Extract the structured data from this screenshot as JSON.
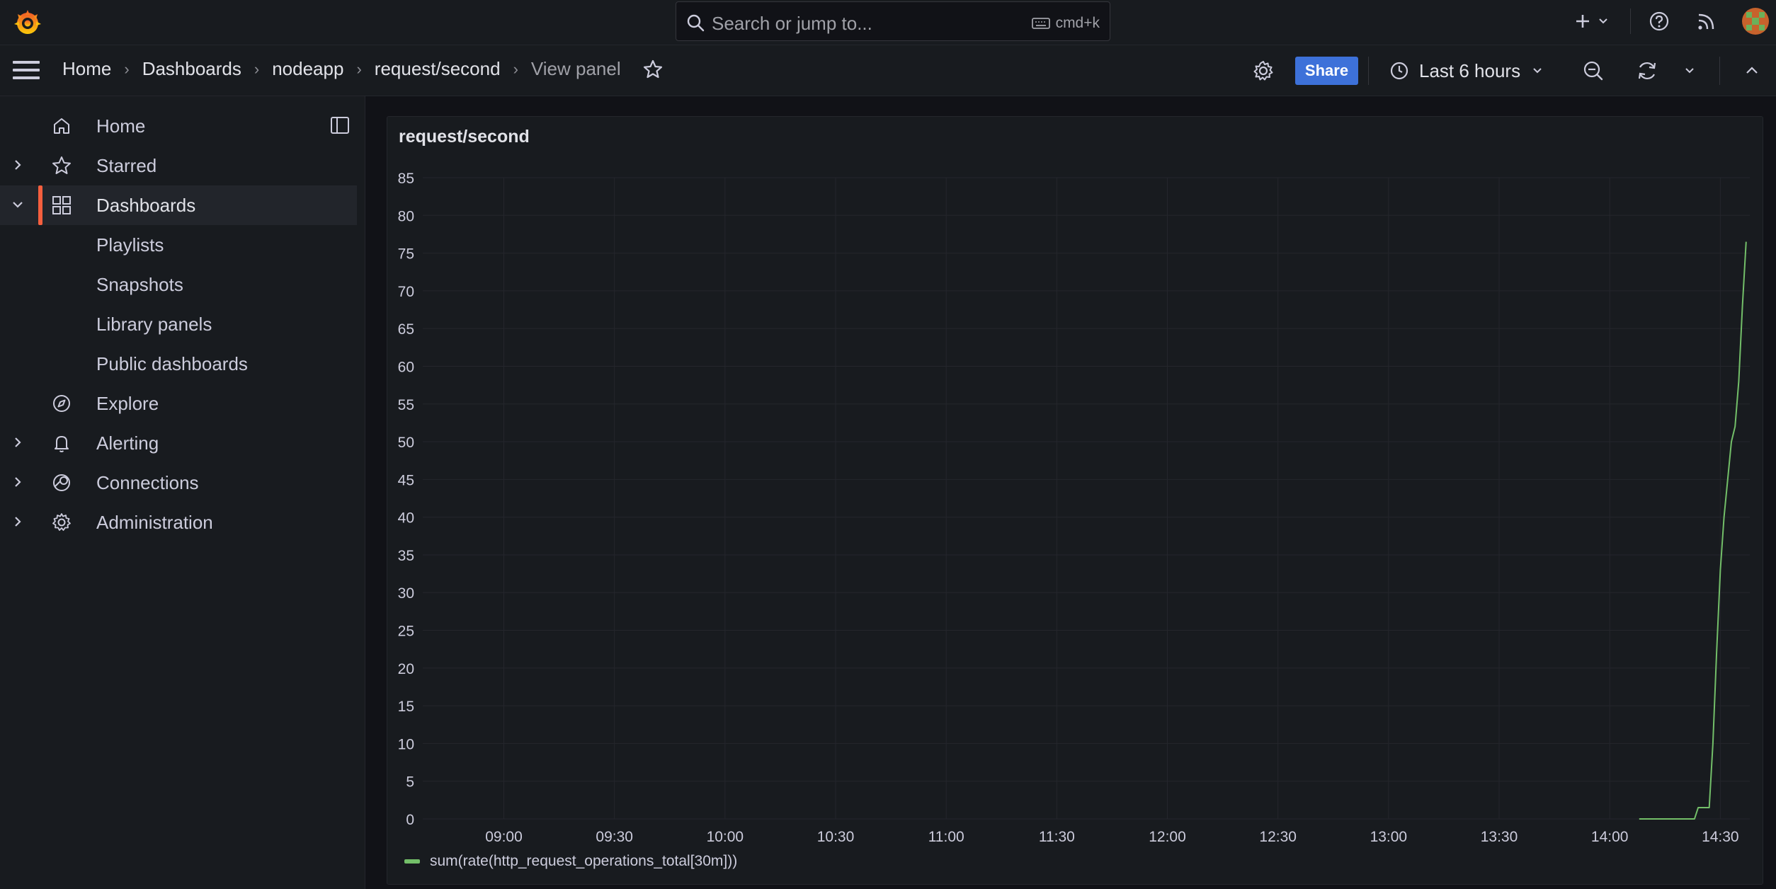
{
  "search": {
    "placeholder": "Search or jump to...",
    "shortcut": "cmd+k"
  },
  "breadcrumb": {
    "items": [
      "Home",
      "Dashboards",
      "nodeapp",
      "request/second",
      "View panel"
    ]
  },
  "toolbar": {
    "share_label": "Share",
    "time_range": "Last 6 hours"
  },
  "sidebar": {
    "items": [
      {
        "label": "Home",
        "icon": "home-icon",
        "expandable": false
      },
      {
        "label": "Starred",
        "icon": "star-icon",
        "expandable": true
      },
      {
        "label": "Dashboards",
        "icon": "dashboards-icon",
        "expandable": true,
        "expanded": true,
        "active": true
      },
      {
        "label": "Playlists",
        "icon": "",
        "child": true
      },
      {
        "label": "Snapshots",
        "icon": "",
        "child": true
      },
      {
        "label": "Library panels",
        "icon": "",
        "child": true
      },
      {
        "label": "Public dashboards",
        "icon": "",
        "child": true
      },
      {
        "label": "Explore",
        "icon": "compass-icon",
        "expandable": false
      },
      {
        "label": "Alerting",
        "icon": "bell-icon",
        "expandable": true
      },
      {
        "label": "Connections",
        "icon": "connections-icon",
        "expandable": true
      },
      {
        "label": "Administration",
        "icon": "cog-icon",
        "expandable": true
      }
    ]
  },
  "panel": {
    "title": "request/second"
  },
  "colors": {
    "accent": "#f55f3e",
    "series": "#73bf69",
    "share": "#3d71d9"
  },
  "chart_data": {
    "type": "line",
    "title": "request/second",
    "ylim": [
      0,
      85
    ],
    "y_ticks": [
      0,
      5,
      10,
      15,
      20,
      25,
      30,
      35,
      40,
      45,
      50,
      55,
      60,
      65,
      70,
      75,
      80,
      85
    ],
    "x_ticks": [
      "09:00",
      "09:30",
      "10:00",
      "10:30",
      "11:00",
      "11:30",
      "12:00",
      "12:30",
      "13:00",
      "13:30",
      "14:00",
      "14:30"
    ],
    "xlim": [
      "08:38",
      "14:38"
    ],
    "grid": true,
    "legend": "bottom-left",
    "series": [
      {
        "name": "sum(rate(http_request_operations_total[30m]))",
        "color": "#73bf69",
        "x": [
          "14:08",
          "14:13",
          "14:18",
          "14:23",
          "14:24",
          "14:26",
          "14:27",
          "14:28",
          "14:29",
          "14:30",
          "14:31",
          "14:32",
          "14:33",
          "14:34",
          "14:35",
          "14:36",
          "14:37"
        ],
        "y": [
          0,
          0,
          0,
          0,
          1.5,
          1.5,
          1.5,
          10,
          22,
          33,
          40,
          45,
          50,
          52,
          58,
          68,
          76.5
        ]
      }
    ]
  }
}
